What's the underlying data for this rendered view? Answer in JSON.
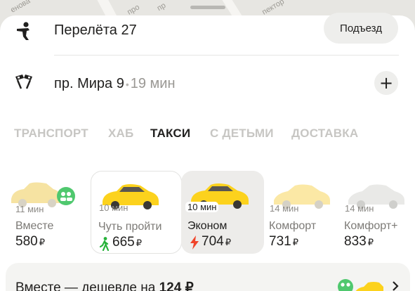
{
  "map": {
    "streets": [
      "енова",
      "про",
      "пр",
      "пектор"
    ]
  },
  "route": {
    "origin": "Перелёта 27",
    "entrance_label": "Подъезд",
    "destination": "пр. Мира 9",
    "separator": "•",
    "duration": "19 мин",
    "add_label": "+"
  },
  "tabs": [
    {
      "label": "ТРАНСПОРТ",
      "active": false
    },
    {
      "label": "ХАБ",
      "active": false
    },
    {
      "label": "ТАКСИ",
      "active": true
    },
    {
      "label": "С ДЕТЬМИ",
      "active": false
    },
    {
      "label": "ДОСТАВКА",
      "active": false
    }
  ],
  "tariffs": [
    {
      "eta": "11 мин",
      "name": "Вместе",
      "price": "580",
      "currency": "₽",
      "icon": "none"
    },
    {
      "eta": "10 мин",
      "name": "Чуть пройти",
      "price": "665",
      "currency": "₽",
      "icon": "walking-person-icon"
    },
    {
      "eta": "10 мин",
      "name": "Эконом",
      "price": "704",
      "currency": "₽",
      "icon": "lightning-icon",
      "selected": true
    },
    {
      "eta": "14 мин",
      "name": "Комфорт",
      "price": "731",
      "currency": "₽",
      "icon": "none"
    },
    {
      "eta": "14 мин",
      "name": "Комфорт+",
      "price": "833",
      "currency": "₽",
      "icon": "none"
    }
  ],
  "promo": {
    "text": "Вместе — дешевле на",
    "amount": "124 ₽"
  },
  "colors": {
    "taxi_yellow": "#fcd21d",
    "walk_green": "#27b23a",
    "lightning_red": "#f0442a",
    "badge_green": "#4fc86e"
  }
}
